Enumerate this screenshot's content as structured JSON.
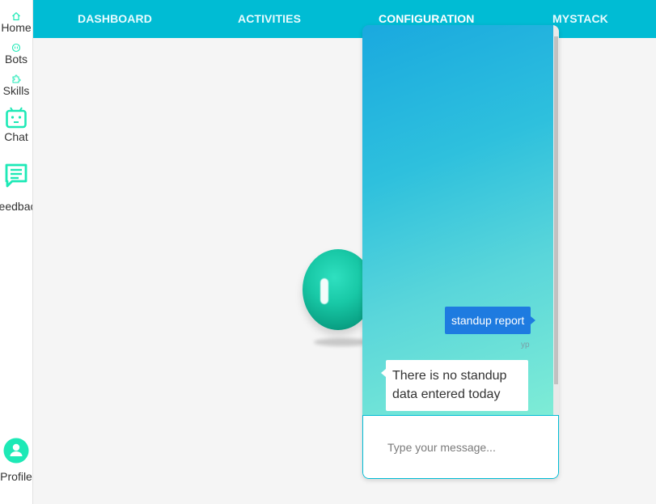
{
  "sidebar": {
    "items": [
      {
        "label": "Home",
        "icon": "home-icon"
      },
      {
        "label": "Bots",
        "icon": "bot-icon"
      },
      {
        "label": "Skills",
        "icon": "puzzle-icon"
      },
      {
        "label": "Chat",
        "icon": "robot-face-icon"
      },
      {
        "label": "Feedback",
        "icon": "feedback-icon"
      },
      {
        "label": "Profile",
        "icon": "profile-icon"
      }
    ]
  },
  "nav": {
    "tabs": [
      {
        "label": "DASHBOARD"
      },
      {
        "label": "ACTIVITIES"
      },
      {
        "label": "CONFIGURATION",
        "active": true
      },
      {
        "label": "MYSTACK"
      }
    ]
  },
  "chat": {
    "messages": [
      {
        "from": "user",
        "text": "standup report",
        "meta": "yp"
      },
      {
        "from": "bot",
        "text": "There is no standup data entered today"
      }
    ],
    "input_placeholder": "Type your message...",
    "input_value": ""
  },
  "colors": {
    "accent": "#00bcd4",
    "sidebar_icon": "#1de9b6",
    "user_bubble": "#1e7be0",
    "active_indicator": "#ff4d6d"
  }
}
